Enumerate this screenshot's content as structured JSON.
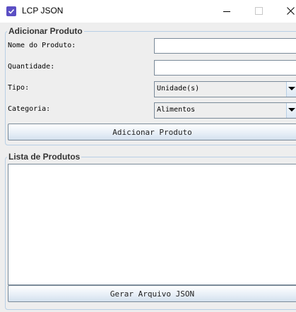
{
  "window": {
    "title": "LCP JSON",
    "icon": "app-check-icon",
    "controls": [
      "minimize-icon",
      "maximize-icon",
      "close-icon"
    ]
  },
  "form": {
    "legend": "Adicionar Produto",
    "name_label": "Nome do Produto:",
    "name_value": "",
    "quantity_label": "Quantidade:",
    "quantity_value": "",
    "type_label": "Tipo:",
    "type_selected": "Unidade(s)",
    "category_label": "Categoria:",
    "category_selected": "Alimentos",
    "add_button": "Adicionar Produto"
  },
  "list": {
    "legend": "Lista de Produtos",
    "items": [],
    "generate_button": "Gerar Arquivo JSON"
  },
  "colors": {
    "icon_bg": "#5b4fc4",
    "group_border": "#b8cfe5",
    "control_border": "#7a8a99"
  }
}
